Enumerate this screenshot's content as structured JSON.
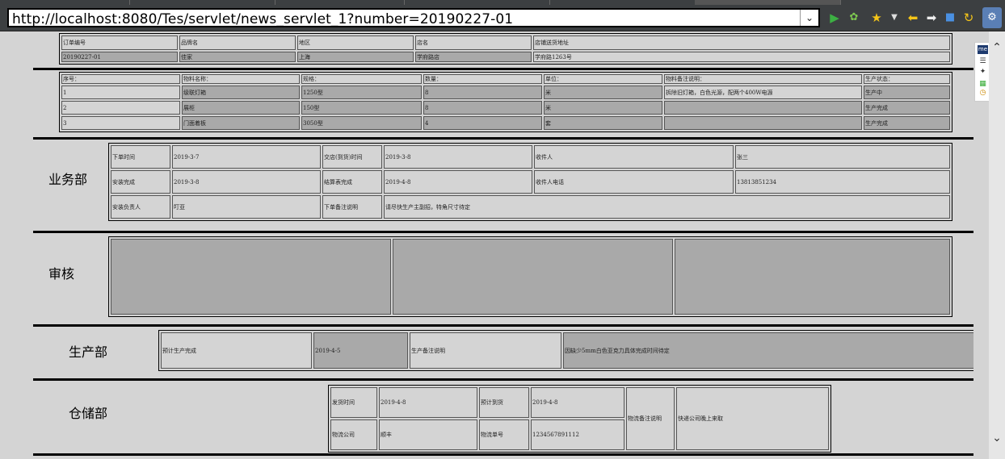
{
  "browser": {
    "url": "http://localhost:8080/Tes/servlet/news_servlet_1?number=20190227-01",
    "dropdown_icon": "chevron-down-icon"
  },
  "order": {
    "headers": [
      "订单编号",
      "品牌名",
      "地区",
      "店名",
      "店铺送货地址"
    ],
    "values": [
      "20190227-01",
      "佳家",
      "上海",
      "学府路店",
      "学府路1263号"
    ]
  },
  "items": {
    "headers": [
      "序号：",
      "物料名称：",
      "规格：",
      "数量：",
      "单位：",
      "物料备注说明：",
      "生产状态："
    ],
    "rows": [
      [
        "1",
        "级联灯箱",
        "1250型",
        "8",
        "米",
        "拆除旧灯箱，白色光源，配两个400W电源",
        "生产中"
      ],
      [
        "2",
        "展柜",
        "150型",
        "8",
        "米",
        "",
        "生产完成"
      ],
      [
        "3",
        "门面着板",
        "3050型",
        "4",
        "套",
        "",
        "生产完成"
      ]
    ]
  },
  "sales": {
    "title": "业务部",
    "order_time_label": "下单时间",
    "order_time": "2019-3-7",
    "deliver_time_label": "交店(到货)时间",
    "deliver_time": "2019-3-8",
    "receiver_label": "收件人",
    "receiver": "张三",
    "install_done_label": "安装完成",
    "install_done": "2019-3-8",
    "settle_done_label": "结算表完成",
    "settle_done": "2019-4-8",
    "receiver_phone_label": "收件人电话",
    "receiver_phone": "13813851234",
    "install_owner_label": "安装负责人",
    "install_owner": "叮亚",
    "order_note_label": "下单备注说明",
    "order_note": "请尽快生产主副招，特角尺寸待定"
  },
  "audit": {
    "title": "审核"
  },
  "production": {
    "title": "生产部",
    "est_done_label": "预计生产完成",
    "est_done": "2019-4-5",
    "note_label": "生产备注说明",
    "note": "因缺少5mm白色亚克力具体完成时间待定"
  },
  "warehouse": {
    "title": "仓储部",
    "ship_time_label": "发货时间",
    "ship_time": "2019-4-8",
    "est_arrival_label": "预计到货",
    "est_arrival": "2019-4-8",
    "logistics_co_label": "物流公司",
    "logistics_co": "顺丰",
    "tracking_label": "物流单号",
    "tracking": "1234567891112",
    "logistics_note_label": "物流备注说明",
    "logistics_note": "快递公司晚上来取"
  }
}
